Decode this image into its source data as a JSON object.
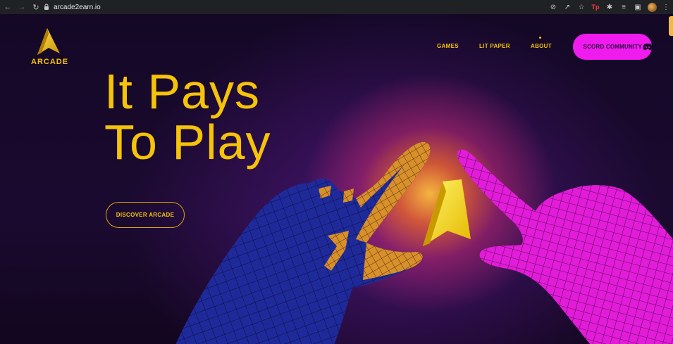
{
  "browser": {
    "url": "arcade2earn.io"
  },
  "site": {
    "logo_text": "ARCADE"
  },
  "nav": {
    "games": "GAMES",
    "lit_paper": "LIT PAPER",
    "about": "ABOUT",
    "discord": "SCORD COMMUNITY"
  },
  "hero": {
    "line1": "It Pays",
    "line2": "To Play",
    "cta": "DISCOVER ARCADE"
  },
  "colors": {
    "accent": "#f5c30a",
    "discord_bg": "#f01cef",
    "background": "#1a0a2e"
  }
}
